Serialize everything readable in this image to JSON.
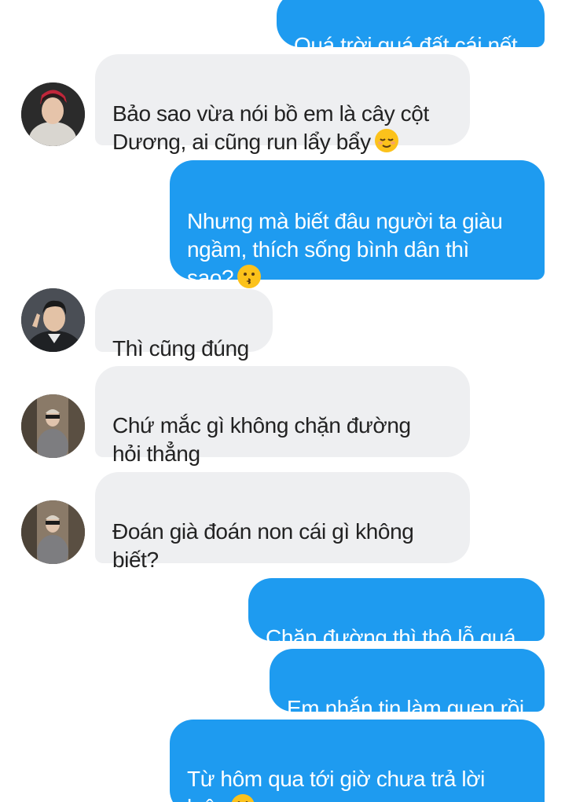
{
  "messages": [
    {
      "id": "m1",
      "side": "out",
      "text": "Quá trời quá đất cái nết",
      "emoji": null
    },
    {
      "id": "m2",
      "side": "in",
      "text": "Bảo sao vừa nói bồ em là cây cột\nDương, ai cũng run lẩy bẩy",
      "emoji": "relieved-face"
    },
    {
      "id": "m3",
      "side": "out",
      "text": "Nhưng mà biết đâu người ta giàu\nngầm, thích sống bình dân thì\nsao?",
      "emoji": "kissing-face"
    },
    {
      "id": "m4",
      "side": "in",
      "text": "Thì cũng đúng",
      "emoji": null
    },
    {
      "id": "m5",
      "side": "in",
      "text": "Chứ mắc gì không chặn đường\nhỏi thẳng",
      "emoji": null
    },
    {
      "id": "m6",
      "side": "in",
      "text": "Đoán già đoán non cái gì không\nbiết?",
      "emoji": null
    },
    {
      "id": "m7",
      "side": "out",
      "text": "Chặn đường thì thô lỗ quá",
      "emoji": null
    },
    {
      "id": "m8",
      "side": "out",
      "text": "Em nhắn tin làm quen rồi",
      "emoji": null
    },
    {
      "id": "m9",
      "side": "out",
      "text": "Từ hôm qua tới giờ chưa trả lời\nluôn",
      "emoji": "slightly-smiling-face"
    }
  ],
  "colors": {
    "outgoing_bubble": "#1e9bf0",
    "incoming_bubble": "#eeeff1",
    "outgoing_text": "#ffffff",
    "incoming_text": "#222222"
  }
}
